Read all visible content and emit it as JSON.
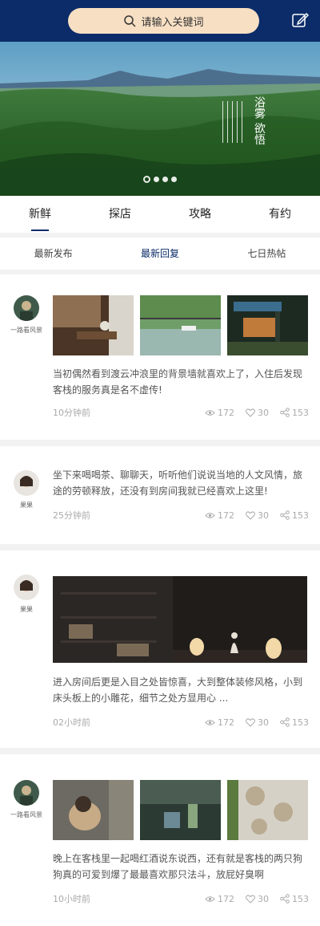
{
  "search": {
    "placeholder": "请输入关键词"
  },
  "banner": {
    "calligraphy": "浴雾 欲悟"
  },
  "tabs": [
    {
      "label": "新鲜",
      "active": true
    },
    {
      "label": "探店"
    },
    {
      "label": "攻略"
    },
    {
      "label": "有约"
    }
  ],
  "subtabs": [
    {
      "label": "最新发布"
    },
    {
      "label": "最新回复",
      "active": true
    },
    {
      "label": "七日热帖"
    }
  ],
  "posts": [
    {
      "user": "一路看风景",
      "text": "当初偶然看到渡云冲浪里的背景墙就喜欢上了，入住后发现客栈的服务真是名不虚传!",
      "time": "10分钟前",
      "views": "172",
      "likes": "30",
      "shares": "153"
    },
    {
      "user": "果果",
      "text": "坐下来喝喝茶、聊聊天，听听他们说说当地的人文风情，旅途的劳顿释放，还没有到房间我就已经喜欢上这里!",
      "time": "25分钟前",
      "views": "172",
      "likes": "30",
      "shares": "153"
    },
    {
      "user": "果果",
      "text": "进入房间后更是入目之处皆惊喜，大到整体装修风格，小到床头板上的小雕花，细节之处方显用心 ...",
      "time": "02小时前",
      "views": "172",
      "likes": "30",
      "shares": "153"
    },
    {
      "user": "一路看风景",
      "text": "晚上在客栈里一起喝红酒说东说西，还有就是客栈的两只狗狗真的可爱到爆了最最喜欢那只法斗，放屁好臭啊",
      "time": "10小时前",
      "views": "172",
      "likes": "30",
      "shares": "153"
    }
  ],
  "colors": {
    "header": "#0b2c68",
    "search_bg": "#f7dfc3"
  }
}
